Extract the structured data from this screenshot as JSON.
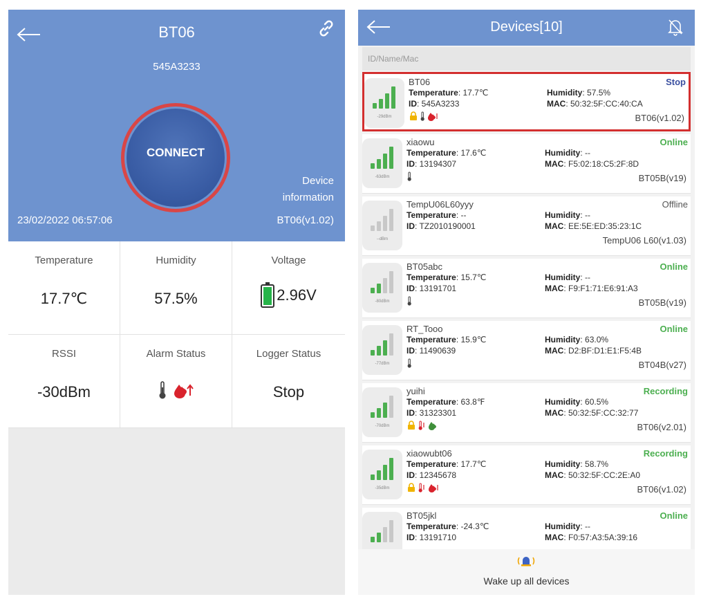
{
  "detail": {
    "title": "BT06",
    "subtitle": "545A3233",
    "connect_label": "CONNECT",
    "device_info_label": "Device information",
    "datetime": "23/02/2022  06:57:06",
    "firmware": "BT06(v1.02)",
    "cells": [
      {
        "label": "Temperature",
        "value": "17.7℃"
      },
      {
        "label": "Humidity",
        "value": "57.5%"
      },
      {
        "label": "Voltage",
        "value": "2.96V"
      },
      {
        "label": "RSSI",
        "value": "-30dBm"
      },
      {
        "label": "Alarm Status",
        "value": ""
      },
      {
        "label": "Logger Status",
        "value": "Stop"
      }
    ],
    "colors": {
      "header": "#6e93cf",
      "ring": "#d94646",
      "button": "#3a5da5"
    },
    "icons": [
      "back-arrow-icon",
      "link-icon",
      "battery-icon",
      "thermometer-icon",
      "humidity-alarm-icon"
    ]
  },
  "devices": {
    "title": "Devices[10]",
    "search_placeholder": "ID/Name/Mac",
    "labels": {
      "temperature": "Temperature",
      "humidity": "Humidity",
      "id": "ID",
      "mac": "MAC"
    },
    "items": [
      {
        "name": "BT06",
        "status": "Stop",
        "temp": "17.7℃",
        "hum": "57.5%",
        "id": "545A3233",
        "mac": "50:32:5F:CC:40:CA",
        "model": "BT06(v1.02)",
        "dbm": "-29dBm",
        "bars": 4
      },
      {
        "name": "xiaowu",
        "status": "Online",
        "temp": "17.6℃",
        "hum": "--",
        "id": "13194307",
        "mac": "F5:02:18:C5:2F:8D",
        "model": "BT05B(v19)",
        "dbm": "-63dBm",
        "bars": 4
      },
      {
        "name": "TempU06L60yyy",
        "status": "Offline",
        "temp": "--",
        "hum": "--",
        "id": "TZ2010190001",
        "mac": "EE:5E:ED:35:23:1C",
        "model": "TempU06 L60(v1.03)",
        "dbm": "--dBm",
        "bars": 0
      },
      {
        "name": "BT05abc",
        "status": "Online",
        "temp": "15.7℃",
        "hum": "--",
        "id": "13191701",
        "mac": "F9:F1:71:E6:91:A3",
        "model": "BT05B(v19)",
        "dbm": "-80dBm",
        "bars": 2
      },
      {
        "name": "RT_Tooo",
        "status": "Online",
        "temp": "15.9℃",
        "hum": "63.0%",
        "id": "11490639",
        "mac": "D2:BF:D1:E1:F5:4B",
        "model": "BT04B(v27)",
        "dbm": "-77dBm",
        "bars": 3
      },
      {
        "name": "yuihi",
        "status": "Recording",
        "temp": "63.8℉",
        "hum": "60.5%",
        "id": "31323301",
        "mac": "50:32:5F:CC:32:77",
        "model": "BT06(v2.01)",
        "dbm": "-70dBm",
        "bars": 3
      },
      {
        "name": "xiaowubt06",
        "status": "Recording",
        "temp": "17.7℃",
        "hum": "58.7%",
        "id": "12345678",
        "mac": "50:32:5F:CC:2E:A0",
        "model": "BT06(v1.02)",
        "dbm": "-35dBm",
        "bars": 4
      },
      {
        "name": "BT05jkl",
        "status": "Online",
        "temp": "-24.3℃",
        "hum": "--",
        "id": "13191710",
        "mac": "F0:57:A3:5A:39:16",
        "model": "",
        "dbm": "",
        "bars": 2
      }
    ],
    "footer_label": "Wake up all devices",
    "colors": {
      "online": "#4caf50",
      "recording": "#4caf50",
      "stop": "#3a4fa0",
      "offline": "#555555",
      "signal_on": "#4caf50",
      "signal_off": "#c8c8c8"
    }
  }
}
